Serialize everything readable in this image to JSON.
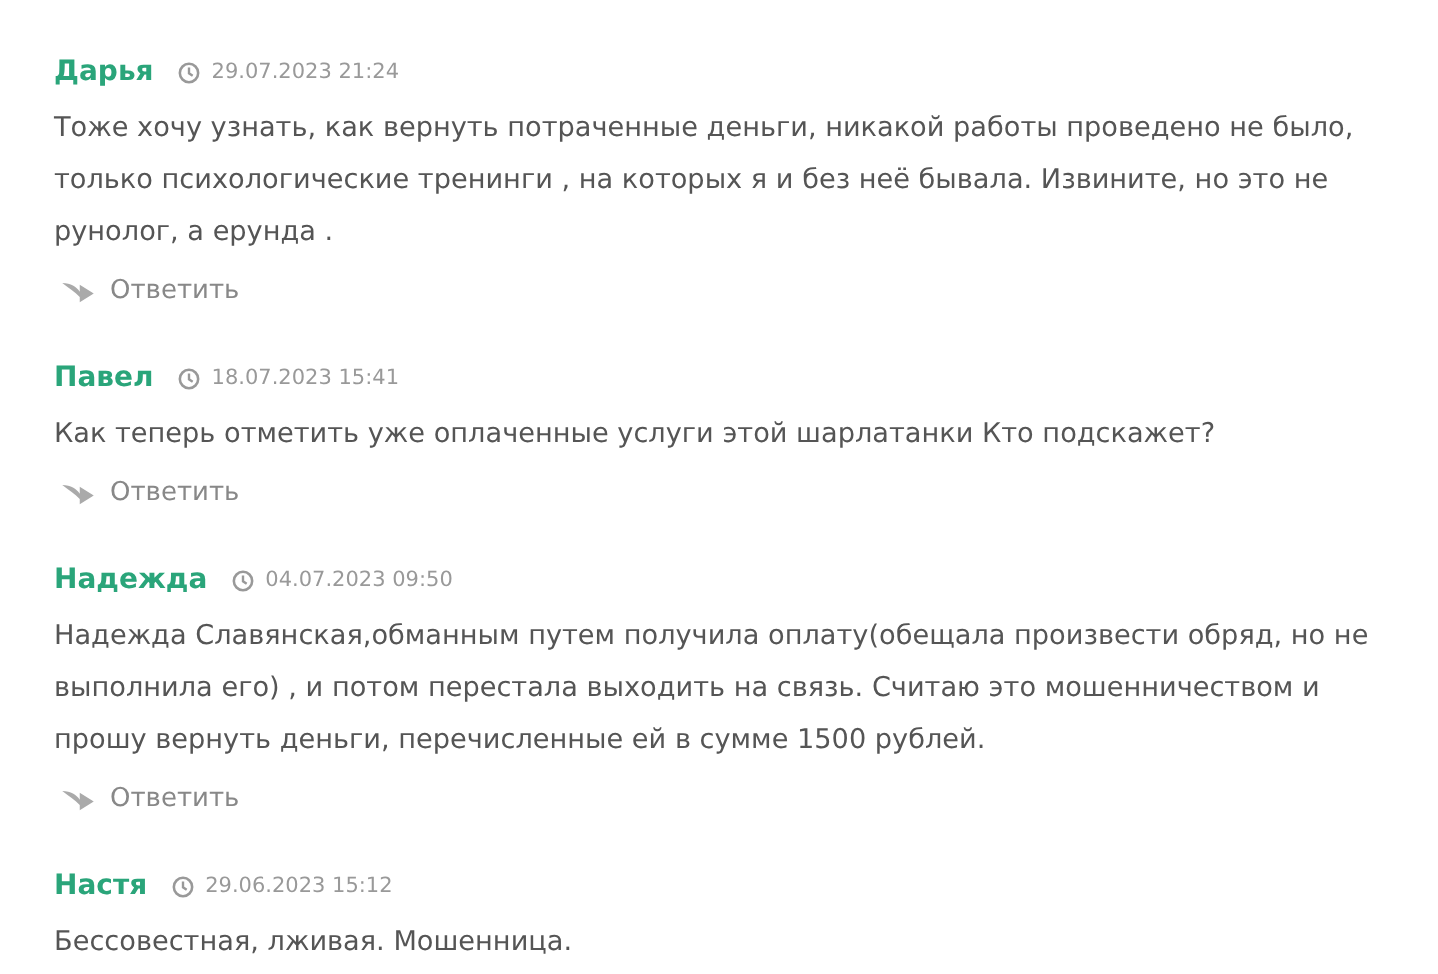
{
  "comments": [
    {
      "author": "Дарья",
      "date": "29.07.2023 21:24",
      "text": "Тоже хочу узнать, как вернуть потраченные деньги, никакой работы проведено не было, только психологические тренинги , на которых я и без неё бывала. Извините, но это не рунолог, а ерунда .",
      "reply": "Ответить"
    },
    {
      "author": "Павел",
      "date": "18.07.2023 15:41",
      "text": "Как теперь отметить уже оплаченные услуги этой шарлатанки Кто подскажет?",
      "reply": "Ответить"
    },
    {
      "author": "Надежда",
      "date": "04.07.2023 09:50",
      "text": "Надежда Славянская,обманным путем получила оплату(обещала произвести обряд, но не выполнила его) , и потом перестала выходить на связь. Считаю это мошенничеством и прошу вернуть деньги, перечисленные ей в сумме 1500 рублей.",
      "reply": "Ответить"
    },
    {
      "author": "Настя",
      "date": "29.06.2023 15:12",
      "text": "Бессовестная, лживая. Мошенница."
    }
  ]
}
